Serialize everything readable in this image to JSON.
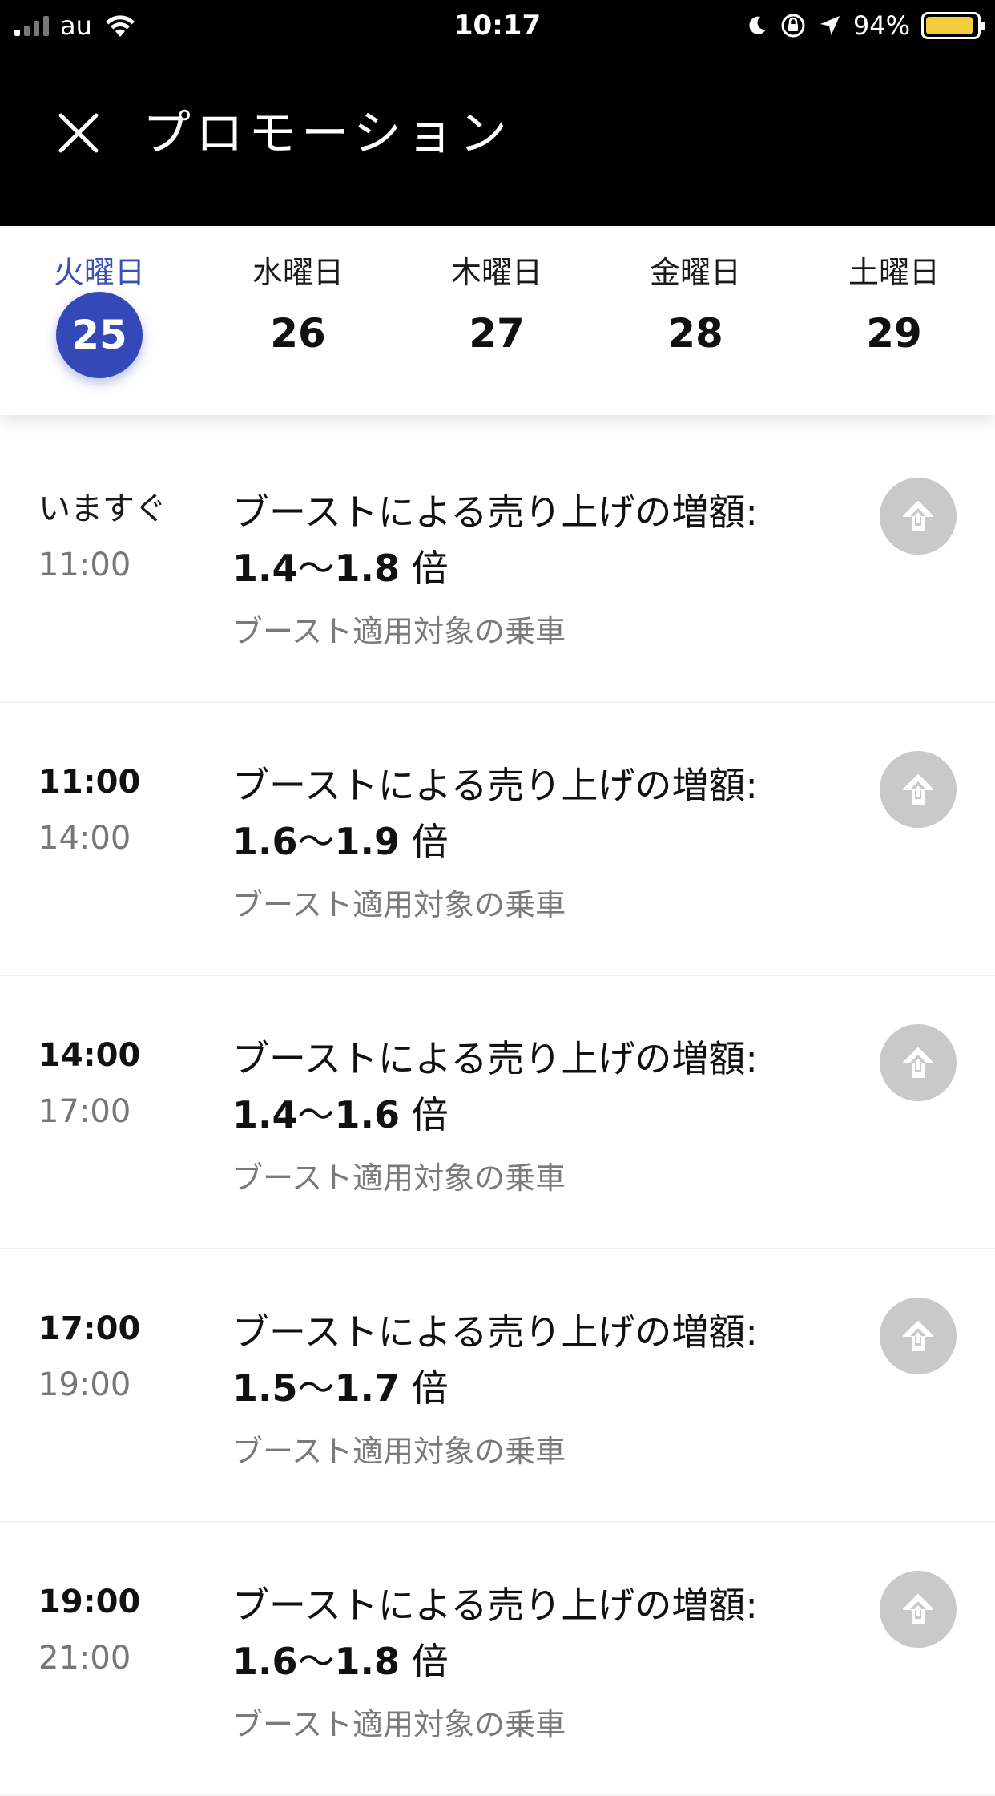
{
  "status_bar": {
    "carrier": "au",
    "time": "10:17",
    "battery_percent": "94%",
    "battery_level": 0.94,
    "battery_color": "#f4cc3c"
  },
  "header": {
    "title": "プロモーション",
    "close_icon": "close-icon"
  },
  "days": [
    {
      "name": "火曜日",
      "date": "25",
      "active": true
    },
    {
      "name": "水曜日",
      "date": "26",
      "active": false
    },
    {
      "name": "木曜日",
      "date": "27",
      "active": false
    },
    {
      "name": "金曜日",
      "date": "28",
      "active": false
    },
    {
      "name": "土曜日",
      "date": "29",
      "active": false
    }
  ],
  "accent_color": "#3548b8",
  "promotions": [
    {
      "start": "いますぐ",
      "end": "11:00",
      "label": "ブーストによる売り上げの増額: ",
      "min": "1.4",
      "sep": "〜",
      "max": "1.8",
      "unit": " 倍",
      "subtitle": "ブースト適用対象の乗車"
    },
    {
      "start": "11:00",
      "end": "14:00",
      "label": "ブーストによる売り上げの増額: ",
      "min": "1.6",
      "sep": "〜",
      "max": "1.9",
      "unit": " 倍",
      "subtitle": "ブースト適用対象の乗車"
    },
    {
      "start": "14:00",
      "end": "17:00",
      "label": "ブーストによる売り上げの増額: ",
      "min": "1.4",
      "sep": "〜",
      "max": "1.6",
      "unit": " 倍",
      "subtitle": "ブースト適用対象の乗車"
    },
    {
      "start": "17:00",
      "end": "19:00",
      "label": "ブーストによる売り上げの増額: ",
      "min": "1.5",
      "sep": "〜",
      "max": "1.7",
      "unit": " 倍",
      "subtitle": "ブースト適用対象の乗車"
    },
    {
      "start": "19:00",
      "end": "21:00",
      "label": "ブーストによる売り上げの増額: ",
      "min": "1.6",
      "sep": "〜",
      "max": "1.8",
      "unit": " 倍",
      "subtitle": "ブースト適用対象の乗車"
    }
  ]
}
